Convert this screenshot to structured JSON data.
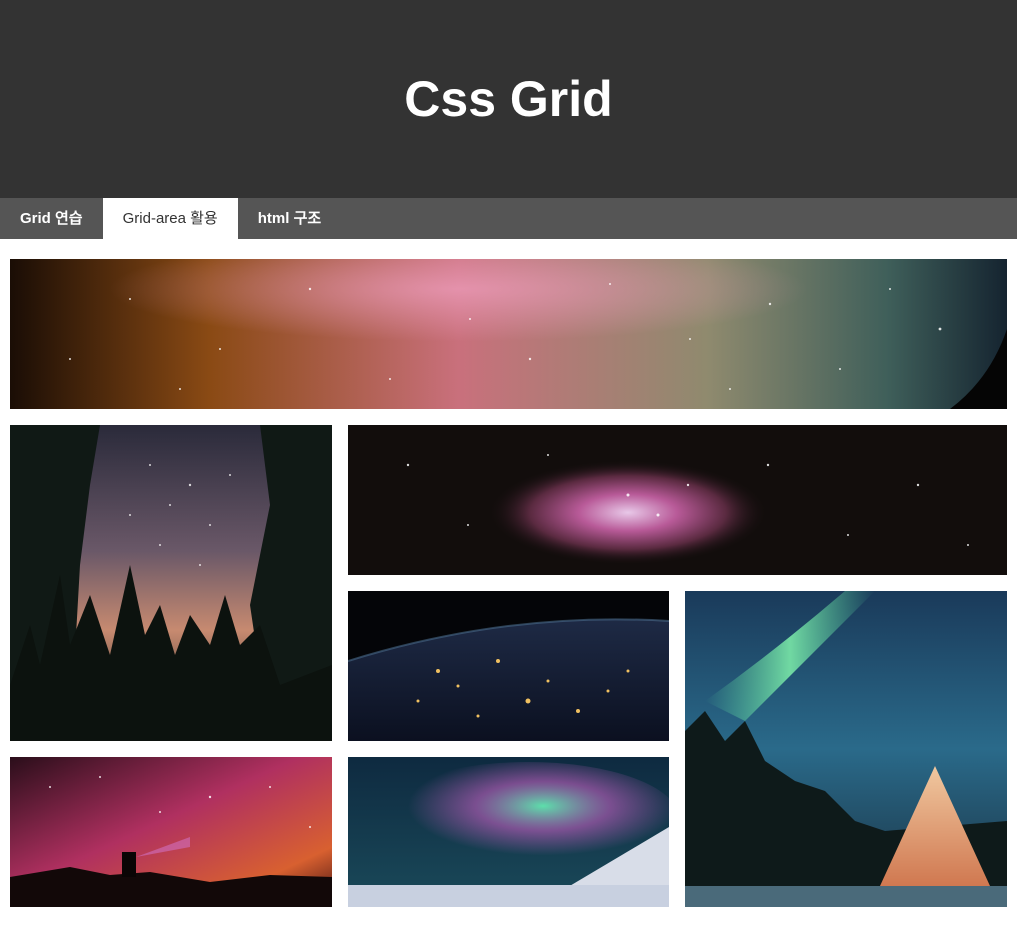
{
  "header": {
    "title": "Css Grid"
  },
  "nav": {
    "tabs": [
      {
        "label": "Grid 연습",
        "active": false
      },
      {
        "label": "Grid-area 활용",
        "active": true
      },
      {
        "label": "html 구조",
        "active": false
      }
    ]
  },
  "colors": {
    "header_bg": "#333333",
    "nav_bg": "#555555",
    "active_tab_bg": "#ffffff",
    "active_tab_text": "#333333"
  },
  "gallery": {
    "images": [
      {
        "subject": "milky-way-panorama"
      },
      {
        "subject": "forest-starry-sky"
      },
      {
        "subject": "orion-nebula"
      },
      {
        "subject": "earth-city-lights"
      },
      {
        "subject": "aurora-teepee"
      },
      {
        "subject": "milky-way-headlamp"
      },
      {
        "subject": "aurora-snowfield"
      }
    ]
  }
}
